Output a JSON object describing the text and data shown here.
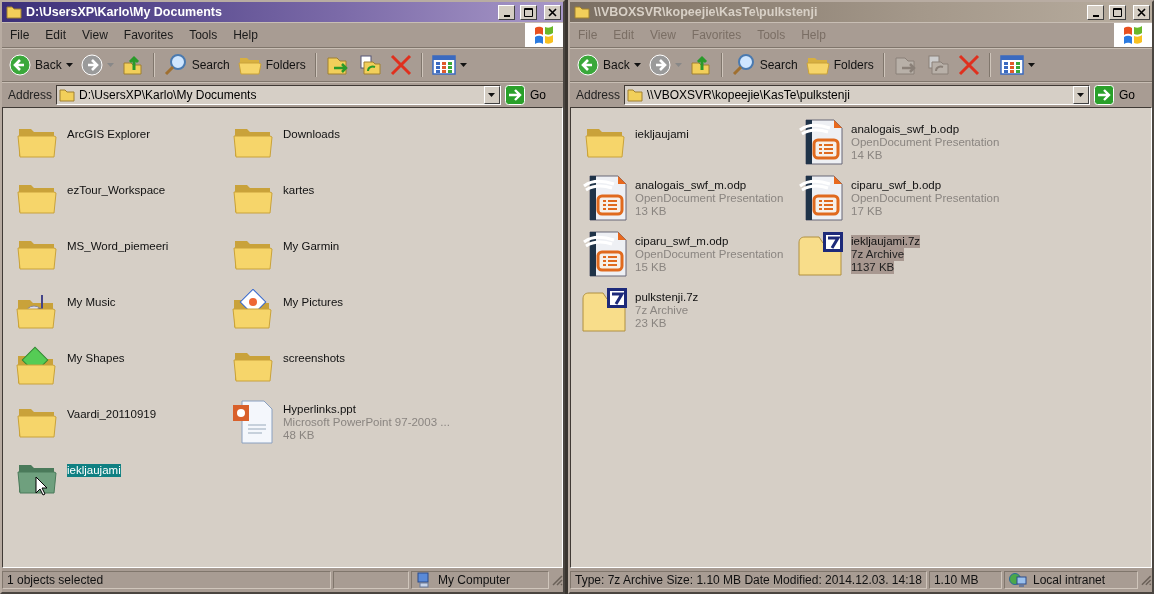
{
  "windows": [
    {
      "title": "D:\\UsersXP\\Karlo\\My Documents",
      "active": true,
      "menu": [
        "File",
        "Edit",
        "View",
        "Favorites",
        "Tools",
        "Help"
      ],
      "nav": [
        {
          "kind": "back",
          "label": "Back",
          "disabled": false
        },
        {
          "kind": "forward",
          "disabled": true
        },
        {
          "kind": "up",
          "disabled": false
        }
      ],
      "tools": [
        {
          "kind": "search",
          "label": "Search"
        },
        {
          "kind": "folders",
          "label": "Folders"
        }
      ],
      "file_tools": [
        {
          "kind": "move",
          "disabled": false
        },
        {
          "kind": "copy",
          "disabled": false
        },
        {
          "kind": "delete",
          "disabled": false
        }
      ],
      "address": {
        "label": "Address",
        "value": "D:\\UsersXP\\Karlo\\My Documents",
        "go": "Go"
      },
      "items": [
        {
          "kind": "folder",
          "name": "ArcGIS Explorer",
          "selected": false
        },
        {
          "kind": "folder",
          "name": "Downloads",
          "selected": false
        },
        {
          "kind": "folder",
          "name": "ezTour_Workspace",
          "selected": false
        },
        {
          "kind": "folder",
          "name": "kartes",
          "selected": false
        },
        {
          "kind": "folder",
          "name": "MS_Word_piemeeri",
          "selected": false
        },
        {
          "kind": "folder",
          "name": "My Garmin",
          "selected": false
        },
        {
          "kind": "music_folder",
          "name": "My Music",
          "selected": false
        },
        {
          "kind": "pictures_folder",
          "name": "My Pictures",
          "selected": false
        },
        {
          "kind": "shapes_folder",
          "name": "My Shapes",
          "selected": false
        },
        {
          "kind": "folder",
          "name": "screenshots",
          "selected": false
        },
        {
          "kind": "folder",
          "name": "Vaardi_20110919",
          "selected": false
        },
        {
          "kind": "ppt",
          "name": "Hyperlinks.ppt",
          "type": "Microsoft PowerPoint 97-2003 ...",
          "size": "48 KB",
          "selected": false
        },
        {
          "kind": "folder",
          "name": "iekljaujami",
          "selected": true,
          "pointer": true
        }
      ],
      "status_bar": {
        "text": "1 objects selected",
        "zone": {
          "kind": "computer",
          "label": "My Computer"
        }
      }
    },
    {
      "title": "\\\\VBOXSVR\\kopeejie\\KasTe\\pulkstenji",
      "active": false,
      "menu": [
        "File",
        "Edit",
        "View",
        "Favorites",
        "Tools",
        "Help"
      ],
      "nav": [
        {
          "kind": "back",
          "label": "Back",
          "disabled": false
        },
        {
          "kind": "forward",
          "disabled": true
        },
        {
          "kind": "up",
          "disabled": false
        }
      ],
      "tools": [
        {
          "kind": "search",
          "label": "Search"
        },
        {
          "kind": "folders",
          "label": "Folders"
        }
      ],
      "file_tools": [
        {
          "kind": "move",
          "disabled": true
        },
        {
          "kind": "copy",
          "disabled": true
        },
        {
          "kind": "delete",
          "disabled": false
        }
      ],
      "address": {
        "label": "Address",
        "value": "\\\\VBOXSVR\\kopeejie\\KasTe\\pulkstenji",
        "go": "Go"
      },
      "items": [
        {
          "kind": "folder",
          "name": "iekljaujami",
          "selected": false
        },
        {
          "kind": "odp",
          "name": "analogais_swf_b.odp",
          "type": "OpenDocument Presentation",
          "size": "14 KB",
          "selected": false
        },
        {
          "kind": "odp",
          "name": "analogais_swf_m.odp",
          "type": "OpenDocument Presentation",
          "size": "13 KB",
          "selected": false
        },
        {
          "kind": "odp",
          "name": "ciparu_swf_b.odp",
          "type": "OpenDocument Presentation",
          "size": "17 KB",
          "selected": false
        },
        {
          "kind": "odp",
          "name": "ciparu_swf_m.odp",
          "type": "OpenDocument Presentation",
          "size": "15 KB",
          "selected": false
        },
        {
          "kind": "archive",
          "name": "iekljaujami.7z",
          "type": "7z Archive",
          "size": "1137 KB",
          "selected": true
        },
        {
          "kind": "archive",
          "name": "pulkstenji.7z",
          "type": "7z Archive",
          "size": "23 KB",
          "selected": false
        }
      ],
      "status_bar": {
        "text": "Type: 7z Archive Size: 1.10 MB Date Modified: 2014.12.03. 14:18",
        "size": "1.10 MB",
        "zone": {
          "kind": "intranet",
          "label": "Local intranet"
        }
      }
    }
  ]
}
